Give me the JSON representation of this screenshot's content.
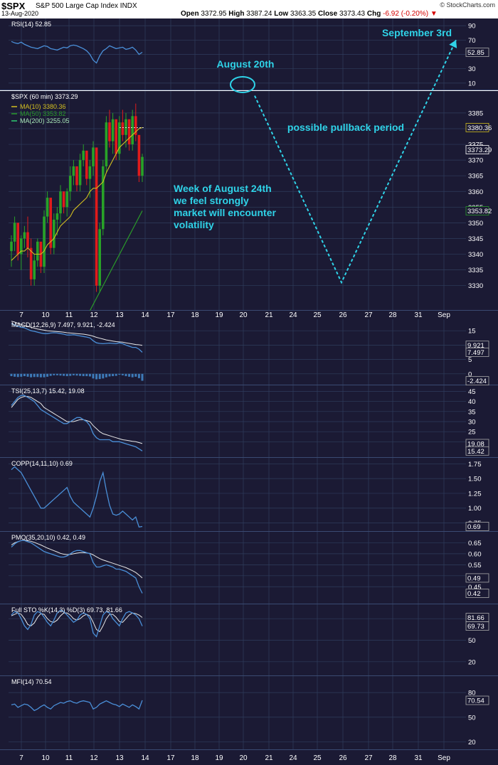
{
  "header": {
    "ticker": "$SPX",
    "name": "S&P 500 Large Cap Index",
    "exchange": "INDX",
    "date": "13-Aug-2020",
    "logo": "© StockCharts.com",
    "open_label": "Open",
    "open": "3372.95",
    "high_label": "High",
    "high": "3387.24",
    "low_label": "Low",
    "low": "3363.35",
    "close_label": "Close",
    "close": "3373.43",
    "chg_label": "Chg",
    "chg": "-6.92 (-0.20%)"
  },
  "colors": {
    "panel_bg": "#1b1a34",
    "grid": "#2f3d5c",
    "up": "#28a228",
    "down": "#e01b1b",
    "annotation": "#2fd3e8",
    "indicator": "#4a8fd8",
    "signal": "#e8e8e8",
    "ma10": "#d4c020",
    "ma50": "#2a9a2a"
  },
  "chart_data": {
    "type": "line",
    "x_axis": {
      "labels": [
        "7",
        "10",
        "11",
        "12",
        "13",
        "14",
        "17",
        "18",
        "19",
        "20",
        "21",
        "24",
        "25",
        "26",
        "27",
        "28",
        "31",
        "Sep"
      ]
    },
    "price": {
      "legend": "$SPX (60 min) 3373.29",
      "ylim": [
        3322,
        3392
      ],
      "ticks": [
        3330,
        3335,
        3340,
        3345,
        3350,
        3355,
        3360,
        3365,
        3370,
        3375,
        3380,
        3385
      ],
      "flags": [
        {
          "text": "3380.36",
          "value": 3380.36,
          "color": "#d4c020"
        },
        {
          "text": "3373.29",
          "value": 3373.29,
          "color": "#ffffff"
        },
        {
          "text": "3353.82",
          "value": 3353.82,
          "color": "#2a9a2a"
        }
      ],
      "candles": [
        [
          3341,
          3346,
          3336,
          3344
        ],
        [
          3344,
          3352,
          3341,
          3350
        ],
        [
          3350,
          3349,
          3338,
          3340
        ],
        [
          3340,
          3346,
          3335,
          3345
        ],
        [
          3345,
          3349,
          3342,
          3347
        ],
        [
          3347,
          3352,
          3339,
          3342
        ],
        [
          3342,
          3345,
          3330,
          3332
        ],
        [
          3332,
          3340,
          3330,
          3338
        ],
        [
          3338,
          3345,
          3336,
          3344
        ],
        [
          3344,
          3342,
          3334,
          3336
        ],
        [
          3336,
          3354,
          3334,
          3352
        ],
        [
          3352,
          3360,
          3350,
          3358
        ],
        [
          3358,
          3356,
          3340,
          3342
        ],
        [
          3342,
          3353,
          3340,
          3351
        ],
        [
          3351,
          3355,
          3346,
          3353
        ],
        [
          3353,
          3362,
          3350,
          3360
        ],
        [
          3360,
          3358,
          3353,
          3355
        ],
        [
          3355,
          3361,
          3352,
          3360
        ],
        [
          3360,
          3368,
          3357,
          3365
        ],
        [
          3365,
          3370,
          3362,
          3368
        ],
        [
          3368,
          3366,
          3360,
          3362
        ],
        [
          3362,
          3372,
          3360,
          3370
        ],
        [
          3370,
          3375,
          3368,
          3373
        ],
        [
          3373,
          3372,
          3362,
          3364
        ],
        [
          3364,
          3370,
          3358,
          3368
        ],
        [
          3368,
          3376,
          3365,
          3374
        ],
        [
          3374,
          3372,
          3328,
          3330
        ],
        [
          3330,
          3350,
          3328,
          3348
        ],
        [
          3348,
          3370,
          3346,
          3368
        ],
        [
          3368,
          3384,
          3366,
          3382
        ],
        [
          3382,
          3386,
          3374,
          3376
        ],
        [
          3376,
          3385,
          3372,
          3383
        ],
        [
          3383,
          3381,
          3370,
          3372
        ],
        [
          3372,
          3384,
          3370,
          3382
        ],
        [
          3382,
          3386,
          3376,
          3378
        ],
        [
          3378,
          3385,
          3374,
          3383
        ],
        [
          3383,
          3381,
          3373,
          3375
        ],
        [
          3375,
          3386,
          3373,
          3384
        ],
        [
          3384,
          3388,
          3376,
          3378
        ],
        [
          3378,
          3374,
          3363,
          3365
        ],
        [
          3365,
          3372,
          3363,
          3371
        ]
      ],
      "ma10": [
        3338,
        3339,
        3340,
        3341,
        3341,
        3342,
        3341,
        3340,
        3340,
        3340,
        3341,
        3343,
        3344,
        3345,
        3347,
        3349,
        3350,
        3351,
        3352,
        3354,
        3355,
        3356,
        3357,
        3358,
        3360,
        3361,
        3361,
        3362,
        3363,
        3366,
        3368,
        3370,
        3372,
        3374,
        3375,
        3376,
        3377,
        3378,
        3379,
        3380,
        3380.36
      ],
      "ma50_start": 3322,
      "ma50_end": 3353.82,
      "ma50_start_index": 24
    },
    "rsi": {
      "legend": "RSI(14) 52.85",
      "ylim": [
        0,
        100
      ],
      "ticks": [
        10,
        30,
        50,
        70,
        90
      ],
      "flag": "52.85",
      "flag_value": 52.85,
      "values": [
        68,
        66,
        65,
        67,
        64,
        62,
        60,
        59,
        58,
        60,
        62,
        61,
        58,
        57,
        56,
        58,
        60,
        59,
        62,
        63,
        62,
        60,
        58,
        55,
        50,
        42,
        38,
        48,
        55,
        58,
        62,
        60,
        58,
        59,
        60,
        57,
        58,
        60,
        56,
        50,
        53
      ]
    },
    "macd": {
      "legend": "MACD(12,26,9) 7.497, 9.921, -2.424",
      "ylim": [
        -4,
        19
      ],
      "ticks": [
        0,
        5,
        10,
        15
      ],
      "flags": [
        {
          "text": "9.921",
          "value": 9.921
        },
        {
          "text": "7.497",
          "value": 7.497
        },
        {
          "text": "-2.424",
          "value": -2.424
        }
      ],
      "macd_line": [
        17.5,
        17,
        16.5,
        16.2,
        16,
        15.5,
        15,
        14.8,
        14.5,
        14.2,
        14,
        14,
        14.2,
        14.3,
        14.2,
        14,
        13.8,
        13.5,
        13.5,
        13.6,
        13.4,
        13.2,
        13,
        12.8,
        12.5,
        11.5,
        10.8,
        10.6,
        10.5,
        10.6,
        10.7,
        10.6,
        10.5,
        10.8,
        10.5,
        10,
        9.6,
        9.2,
        9.2,
        8.6,
        7.5
      ],
      "signal_line": [
        18.3,
        18,
        17.6,
        17.2,
        16.8,
        16.5,
        16.2,
        15.9,
        15.6,
        15.4,
        15.2,
        15,
        14.9,
        14.8,
        14.7,
        14.6,
        14.5,
        14.3,
        14.2,
        14.1,
        14,
        13.9,
        13.8,
        13.6,
        13.4,
        13.1,
        12.7,
        12.4,
        12.1,
        11.8,
        11.6,
        11.4,
        11.2,
        11.1,
        11,
        10.8,
        10.6,
        10.4,
        10.2,
        10.1,
        9.9
      ],
      "histogram": [
        -0.8,
        -1,
        -1.1,
        -1,
        -0.8,
        -1,
        -1.2,
        -1.1,
        -1.1,
        -1.2,
        -1.2,
        -1,
        -0.7,
        -0.5,
        -0.5,
        -0.6,
        -0.7,
        -0.8,
        -0.7,
        -0.5,
        -0.6,
        -0.7,
        -0.8,
        -0.8,
        -0.9,
        -1.6,
        -1.9,
        -1.8,
        -1.6,
        -1.2,
        -0.9,
        -0.8,
        -0.7,
        -0.3,
        -0.5,
        -0.8,
        -1,
        -1.2,
        -1,
        -1.5,
        -2.4
      ]
    },
    "tsi": {
      "legend": "TSI(25,13,7) 15.42, 19.08",
      "ylim": [
        12,
        48
      ],
      "ticks": [
        20,
        25,
        30,
        35,
        40,
        45
      ],
      "flags": [
        {
          "text": "19.08",
          "value": 19.08
        },
        {
          "text": "15.42",
          "value": 15.42
        }
      ],
      "tsi_line": [
        38,
        40,
        42,
        43,
        43,
        42,
        41,
        40,
        38,
        36,
        35,
        34,
        33,
        32,
        31,
        30,
        29,
        29,
        30,
        31,
        32,
        32,
        31,
        30,
        28,
        24,
        22,
        21,
        21,
        21,
        21,
        20,
        20,
        20,
        19.5,
        19,
        18.5,
        18,
        17.5,
        16.5,
        15.42
      ],
      "signal_line": [
        37,
        39,
        41,
        42,
        42.5,
        42.5,
        42,
        41,
        40,
        39,
        37,
        36,
        35,
        34,
        33,
        32,
        31,
        30,
        30,
        30,
        30.5,
        31,
        31,
        30.5,
        30,
        28,
        26.5,
        25,
        24,
        23.5,
        23,
        22.5,
        22,
        21.5,
        21,
        20.8,
        20.5,
        20.2,
        20,
        19.6,
        19.08
      ]
    },
    "copp": {
      "legend": "COPP(14,11,10) 0.69",
      "ylim": [
        0.6,
        1.85
      ],
      "ticks": [
        0.75,
        1.0,
        1.25,
        1.5,
        1.75
      ],
      "flag": "0.69",
      "flag_value": 0.69,
      "values": [
        1.65,
        1.7,
        1.65,
        1.6,
        1.5,
        1.4,
        1.3,
        1.2,
        1.1,
        1.0,
        1.0,
        1.05,
        1.1,
        1.15,
        1.2,
        1.25,
        1.3,
        1.35,
        1.2,
        1.1,
        1.05,
        1.0,
        0.95,
        0.9,
        0.85,
        1.0,
        1.2,
        1.45,
        1.6,
        1.3,
        1.05,
        0.9,
        0.88,
        0.9,
        0.95,
        0.9,
        0.85,
        0.8,
        0.85,
        0.68,
        0.69
      ]
    },
    "pmo": {
      "legend": "PMO(35,20,10) 0.42, 0.49",
      "ylim": [
        0.37,
        0.7
      ],
      "ticks": [
        0.45,
        0.5,
        0.55,
        0.6,
        0.65
      ],
      "flags": [
        {
          "text": "0.49",
          "value": 0.49
        },
        {
          "text": "0.42",
          "value": 0.42
        }
      ],
      "pmo_line": [
        0.63,
        0.645,
        0.655,
        0.66,
        0.66,
        0.655,
        0.65,
        0.64,
        0.63,
        0.62,
        0.61,
        0.605,
        0.6,
        0.595,
        0.59,
        0.585,
        0.585,
        0.59,
        0.6,
        0.61,
        0.615,
        0.615,
        0.61,
        0.605,
        0.6,
        0.56,
        0.54,
        0.54,
        0.545,
        0.55,
        0.545,
        0.54,
        0.53,
        0.53,
        0.525,
        0.52,
        0.51,
        0.5,
        0.49,
        0.45,
        0.42
      ],
      "signal_line": [
        0.64,
        0.65,
        0.655,
        0.66,
        0.662,
        0.66,
        0.657,
        0.652,
        0.646,
        0.64,
        0.633,
        0.626,
        0.62,
        0.614,
        0.608,
        0.602,
        0.598,
        0.596,
        0.597,
        0.6,
        0.603,
        0.605,
        0.605,
        0.604,
        0.602,
        0.595,
        0.586,
        0.578,
        0.572,
        0.567,
        0.562,
        0.557,
        0.552,
        0.547,
        0.542,
        0.537,
        0.53,
        0.523,
        0.515,
        0.503,
        0.49
      ]
    },
    "sto": {
      "legend": "Full STO %K(14,3) %D(3) 69.73, 81.66",
      "ylim": [
        0,
        100
      ],
      "ticks": [
        20,
        50,
        80
      ],
      "flags": [
        {
          "text": "81.66",
          "value": 81.66
        },
        {
          "text": "69.73",
          "value": 69.73
        }
      ],
      "k_line": [
        85,
        90,
        88,
        80,
        70,
        65,
        72,
        85,
        90,
        88,
        82,
        75,
        70,
        78,
        88,
        92,
        90,
        85,
        80,
        75,
        78,
        85,
        88,
        86,
        80,
        60,
        55,
        70,
        85,
        90,
        88,
        80,
        75,
        70,
        80,
        88,
        90,
        88,
        85,
        80,
        69.73
      ],
      "d_line": [
        84,
        86,
        88,
        86,
        80,
        72,
        70,
        74,
        82,
        87,
        86,
        80,
        76,
        75,
        78,
        84,
        88,
        88,
        85,
        80,
        78,
        80,
        84,
        86,
        84,
        75,
        65,
        62,
        70,
        80,
        86,
        86,
        82,
        76,
        75,
        80,
        85,
        88,
        87,
        85,
        81.66
      ]
    },
    "mfi": {
      "legend": "MFI(14) 70.54",
      "ylim": [
        10,
        100
      ],
      "ticks": [
        20,
        50,
        80
      ],
      "flag": "70.54",
      "flag_value": 70.54,
      "values": [
        65,
        66,
        62,
        64,
        66,
        65,
        62,
        58,
        60,
        63,
        65,
        62,
        60,
        64,
        66,
        68,
        67,
        69,
        70,
        68,
        67,
        69,
        70,
        69,
        68,
        60,
        62,
        66,
        68,
        70,
        68,
        66,
        65,
        63,
        66,
        64,
        62,
        65,
        63,
        60,
        70.54
      ]
    },
    "annotations": {
      "august": "August 20th",
      "september": "September 3rd",
      "pullback": "possible pullback period",
      "week": [
        "Week of August 24th",
        "we feel strongly",
        "market will encounter",
        "volatility"
      ],
      "forecast_path": [
        {
          "date": "20",
          "price": 3390.5
        },
        {
          "date": "26",
          "price": 3331
        },
        {
          "date": "Sep",
          "value_panel": "RSI",
          "value": 70
        }
      ]
    }
  }
}
